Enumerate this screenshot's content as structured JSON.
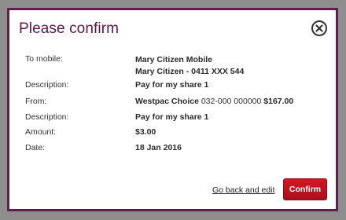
{
  "dialog": {
    "title": "Please confirm",
    "close_icon": "close-circle-icon"
  },
  "details": {
    "to_mobile": {
      "label": "To mobile:",
      "name": "Mary Citizen Mobile",
      "number": "Mary Citizen - 0411 XXX 544"
    },
    "description1": {
      "label": "Description:",
      "value": "Pay for my share 1"
    },
    "from": {
      "label": "From:",
      "account_name": "Westpac Choice",
      "account_number": "032-000 000000",
      "balance": "$167.00"
    },
    "description2": {
      "label": "Description:",
      "value": "Pay for my share 1"
    },
    "amount": {
      "label": "Amount:",
      "value": "$3.00"
    },
    "date": {
      "label": "Date:",
      "value": "18 Jan 2016"
    }
  },
  "footer": {
    "back_link": "Go back and edit",
    "confirm_label": "Confirm"
  },
  "colors": {
    "accent": "#5b1746",
    "confirm": "#c00f1e",
    "backdrop": "#8e8e8e"
  }
}
